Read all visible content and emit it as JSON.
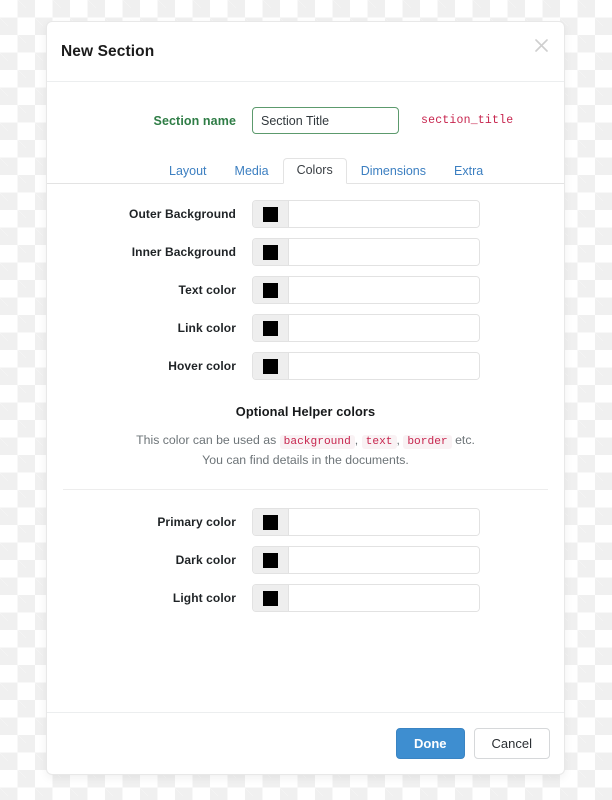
{
  "modal": {
    "title": "New Section",
    "close_icon": "close-icon"
  },
  "section_name": {
    "label": "Section name",
    "value": "Section Title",
    "placeholder": "Section Title",
    "slug": "section_title",
    "label_color": "#2f7d46",
    "slug_color": "#c7254e"
  },
  "tabs": [
    {
      "label": "Layout",
      "active": false
    },
    {
      "label": "Media",
      "active": false
    },
    {
      "label": "Colors",
      "active": true
    },
    {
      "label": "Dimensions",
      "active": false
    },
    {
      "label": "Extra",
      "active": false
    }
  ],
  "color_rows": [
    {
      "label": "Outer Background",
      "swatch": "#000000",
      "value": "",
      "placeholder": ""
    },
    {
      "label": "Inner Background",
      "swatch": "#000000",
      "value": "",
      "placeholder": ""
    },
    {
      "label": "Text color",
      "swatch": "#000000",
      "value": "",
      "placeholder": ""
    },
    {
      "label": "Link color",
      "swatch": "#000000",
      "value": "",
      "placeholder": ""
    },
    {
      "label": "Hover color",
      "swatch": "#000000",
      "value": "",
      "placeholder": ""
    }
  ],
  "helper": {
    "title": "Optional Helper colors",
    "line1_prefix": "This color can be used as",
    "token1": "background",
    "sep1": ",",
    "token2": "text",
    "sep2": ",",
    "token3": "border",
    "line1_suffix": "etc.",
    "line2": "You can find details in the documents."
  },
  "helper_rows": [
    {
      "label": "Primary color",
      "swatch": "#000000",
      "value": "",
      "placeholder": ""
    },
    {
      "label": "Dark color",
      "swatch": "#000000",
      "value": "",
      "placeholder": ""
    },
    {
      "label": "Light color",
      "swatch": "#000000",
      "value": "",
      "placeholder": ""
    }
  ],
  "footer": {
    "done_label": "Done",
    "cancel_label": "Cancel",
    "primary_color": "#3e8ed0"
  }
}
